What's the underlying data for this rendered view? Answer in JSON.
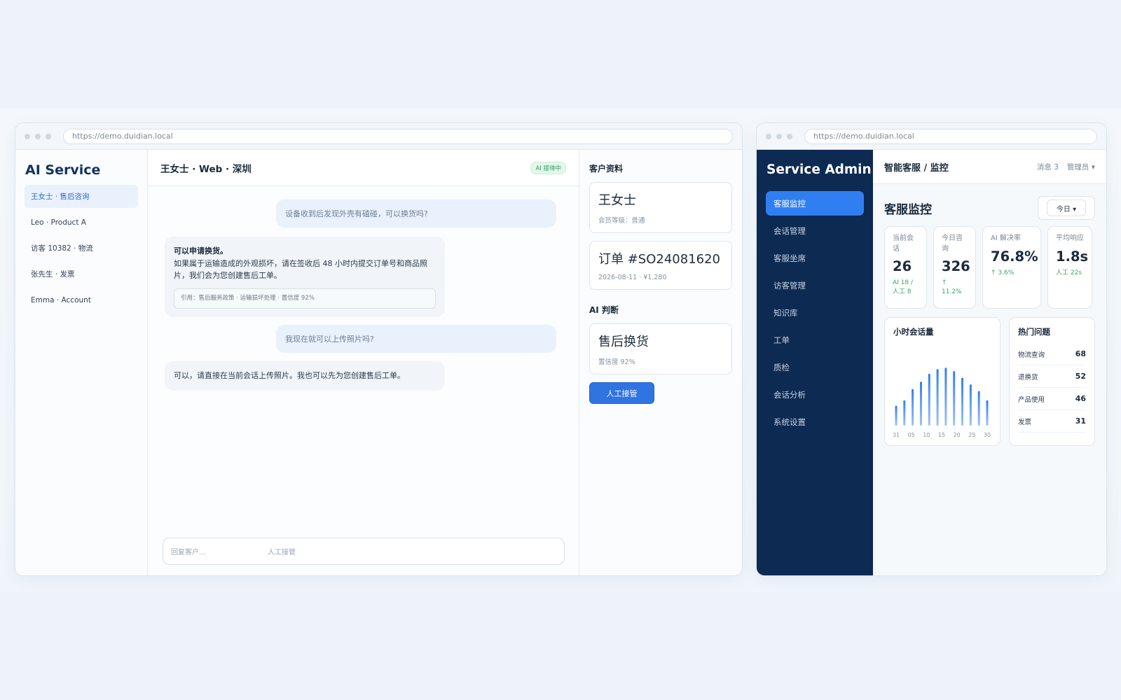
{
  "left_window": {
    "url": "https://demo.duidian.local",
    "brand": "AI Service",
    "conversations": [
      {
        "label": "王女士 · 售后咨询"
      },
      {
        "label": "Leo · Product A"
      },
      {
        "label": "访客 10382 · 物流"
      },
      {
        "label": "张先生 · 发票"
      },
      {
        "label": "Emma · Account"
      }
    ],
    "chat": {
      "title": "王女士 · Web · 深圳",
      "status_badge": "AI 接待中",
      "messages": [
        {
          "role": "user",
          "text": "设备收到后发现外壳有磕碰，可以换货吗?"
        },
        {
          "role": "ai",
          "heading": "可以申请换货。",
          "text": "如果属于运输造成的外观损坏，请在签收后 48 小时内提交订单号和商品照片，我们会为您创建售后工单。",
          "citation": "引用：售后服务政策 · 运输损坏处理 · 置信度 92%"
        },
        {
          "role": "user",
          "text": "我现在就可以上传照片吗?"
        },
        {
          "role": "ai",
          "text": "可以，请直接在当前会话上传照片。我也可以先为您创建售后工单。"
        }
      ],
      "reply_placeholder": "回复客户…",
      "reply_action": "人工接管"
    },
    "profile": {
      "section_title": "客户资料",
      "customer_name": "王女士",
      "member_level": "会员等级：普通",
      "order_title": "订单 #SO24081620",
      "order_meta": "2026-08-11 · ¥1,280",
      "ai_section_title": "AI 判断",
      "ai_judgement": "售后换货",
      "ai_confidence": "置信度 92%",
      "takeover_button": "人工接管"
    }
  },
  "right_window": {
    "url": "https://demo.duidian.local",
    "brand": "Service Admin",
    "nav": [
      {
        "label": "客服监控",
        "active": true
      },
      {
        "label": "会话管理"
      },
      {
        "label": "客服坐席"
      },
      {
        "label": "访客管理"
      },
      {
        "label": "知识库"
      },
      {
        "label": "工单"
      },
      {
        "label": "质检"
      },
      {
        "label": "会话分析"
      },
      {
        "label": "系统设置"
      }
    ],
    "breadcrumb": "智能客服 / 监控",
    "messages_label": "消息 3",
    "admin_label": "管理员 ▾",
    "page_title": "客服监控",
    "range_label": "今日 ▾",
    "kpis": [
      {
        "label": "当前会话",
        "value": "26",
        "delta": "AI 18 / 人工 8"
      },
      {
        "label": "今日咨询",
        "value": "326",
        "delta": "↑ 11.2%"
      },
      {
        "label": "AI 解决率",
        "value": "76.8%",
        "delta": "↑ 3.6%"
      },
      {
        "label": "平均响应",
        "value": "1.8s",
        "delta": "人工 22s"
      }
    ],
    "hourly_chart_title": "小时会话量",
    "hot_title": "热门问题",
    "hot_topics": [
      {
        "name": "物流查询",
        "count": "68"
      },
      {
        "name": "退换货",
        "count": "52"
      },
      {
        "name": "产品使用",
        "count": "46"
      },
      {
        "name": "发票",
        "count": "31"
      }
    ]
  },
  "chart_data": {
    "type": "bar",
    "title": "小时会话量",
    "x_tick_labels": [
      "01",
      "05",
      "10",
      "15",
      "20",
      "25",
      "30"
    ],
    "values": [
      30,
      38,
      55,
      66,
      78,
      85,
      87,
      82,
      72,
      62,
      52,
      38
    ],
    "color": "#2f7ff1"
  }
}
